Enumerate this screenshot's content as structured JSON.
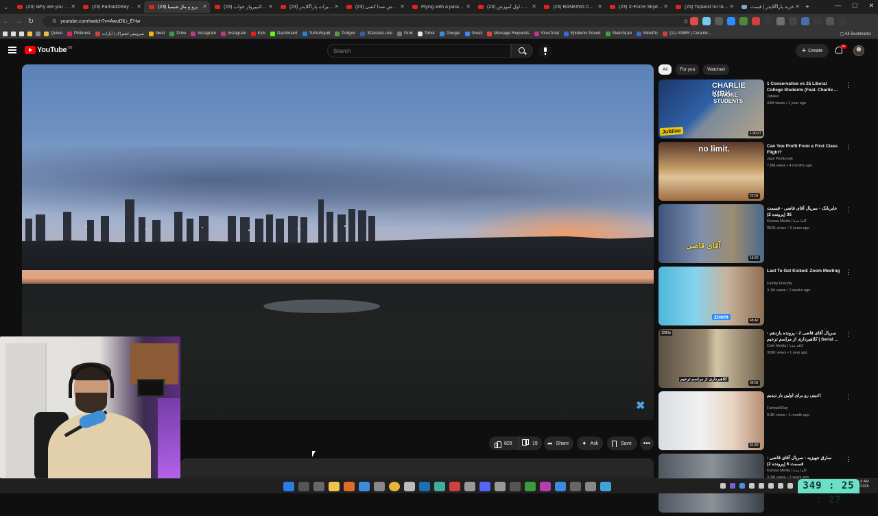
{
  "browser": {
    "tabs": [
      {
        "label": "(23) Why are you still",
        "icon": "youtube-icon"
      },
      {
        "label": "(23) FarhadXRay - You",
        "icon": "youtube-icon"
      },
      {
        "label": "(23) پرو و ماژ شیمیا",
        "icon": "youtube-icon",
        "active": true
      },
      {
        "label": "(23) آخرین #بپیرواز جواب",
        "icon": "youtube-icon"
      },
      {
        "label": "(23) تجهیزات پاراگلایدر",
        "icon": "youtube-icon"
      },
      {
        "label": "(23) آموزش صدا کشی",
        "icon": "youtube-icon"
      },
      {
        "label": "Flying with a paraglide",
        "icon": "youtube-icon"
      },
      {
        "label": "(23) آموزش ـ اول آموزش",
        "icon": "youtube-icon"
      },
      {
        "label": "(23) RANKING CRAZI",
        "icon": "youtube-icon"
      },
      {
        "label": "(23) X-Force Skydivin",
        "icon": "youtube-icon"
      },
      {
        "label": "(23) Topland for tando",
        "icon": "youtube-icon"
      },
      {
        "label": "خرید پاراگلایدر | قیمت",
        "icon": "web-icon"
      }
    ],
    "url": "youtube.com/watch?v=AwuDlLi_EHw",
    "bookmarks": [
      "Quixel",
      "Pinterest",
      "سرویس اشتراک | آپارات",
      "Meet",
      "Drive",
      "Instagram",
      "Instagram",
      "Kick",
      "Dashboard",
      "TurboSquid",
      "Poligon",
      "3Dassets.one",
      "Grok",
      "Timer",
      "Google",
      "Gmail",
      "Message Requests",
      "VirusTotal",
      "Epidemic Sound",
      "SketchLab",
      "MinePic",
      "(11) ASMR | Ceramic..."
    ],
    "all_bookmarks_label": "All Bookmarks"
  },
  "yt": {
    "logo_text": "YouTube",
    "country_code": "GB",
    "search_placeholder": "Search",
    "create_label": "Create",
    "notification_count": "9+"
  },
  "actions": {
    "likes": "828",
    "dislikes": "19",
    "share_label": "Share",
    "ask_label": "Ask",
    "save_label": "Save"
  },
  "chips": [
    "All",
    "For you",
    "Watched"
  ],
  "recommendations": [
    {
      "title": "1 Conservative vs 25 Liberal College Students (Feat. Charlie ...",
      "channel": "Jubilee",
      "meta": "43M views • 1 year ago",
      "duration": "1:30:27",
      "overlay": "CHARLIE KIRK",
      "overlay2": "25 WOKE STUDENTS"
    },
    {
      "title": "Can You Profit From a First Class Flight?",
      "channel": "Jack Pembrook",
      "meta": "7.8M views • 4 months ago",
      "duration": "22:56",
      "overlay": "no limit."
    },
    {
      "title": "عابربانک - سریال آقای قاضی - قسمت 36 (پرونده 2)",
      "channel": "Kamaa Media | کاما مدیا",
      "meta": "951K views • 3 years ago",
      "duration": "19:20",
      "overlay": "آقای قاضی"
    },
    {
      "title": "Last To Get Kicked: Zoom Meeting",
      "channel": "Family Friendly",
      "meta": "3.1M views • 2 weeks ago",
      "duration": "48:42",
      "overlay": "zoom"
    },
    {
      "title": "سریال آقای قاضی 2 - پرونده یازدهم - کلاهبرداری از مراسم ترحیم | Serial ...",
      "channel": "Cafe Media | کافه مدیا",
      "meta": "359K views • 1 year ago",
      "duration": "39:56",
      "overlay": "کلاهبرداری از مراسم ترحیم"
    },
    {
      "title": "دینی رو برای اولین بار دیدیم!!",
      "channel": "FarhadXRay",
      "meta": "9.3K views • 1 month ago",
      "duration": "31:20",
      "overlay": ""
    },
    {
      "title": "سارق جهیزیه - سریال آقای قاضی - قسمت 6 (پرونده 2)",
      "channel": "Kamaa Media | کاما مدیا",
      "meta": "3.3M views • 3 years ago",
      "duration": "",
      "overlay": ""
    }
  ],
  "taskbar": {
    "timer": "349 : 25 : 27",
    "clock_time": "9 AM",
    "clock_date": "/2026"
  },
  "colors": {
    "yt_red": "#ff0000",
    "page_bg": "#0f0f0f",
    "pill_bg": "#272727",
    "timer_bg": "#6be0c8"
  }
}
